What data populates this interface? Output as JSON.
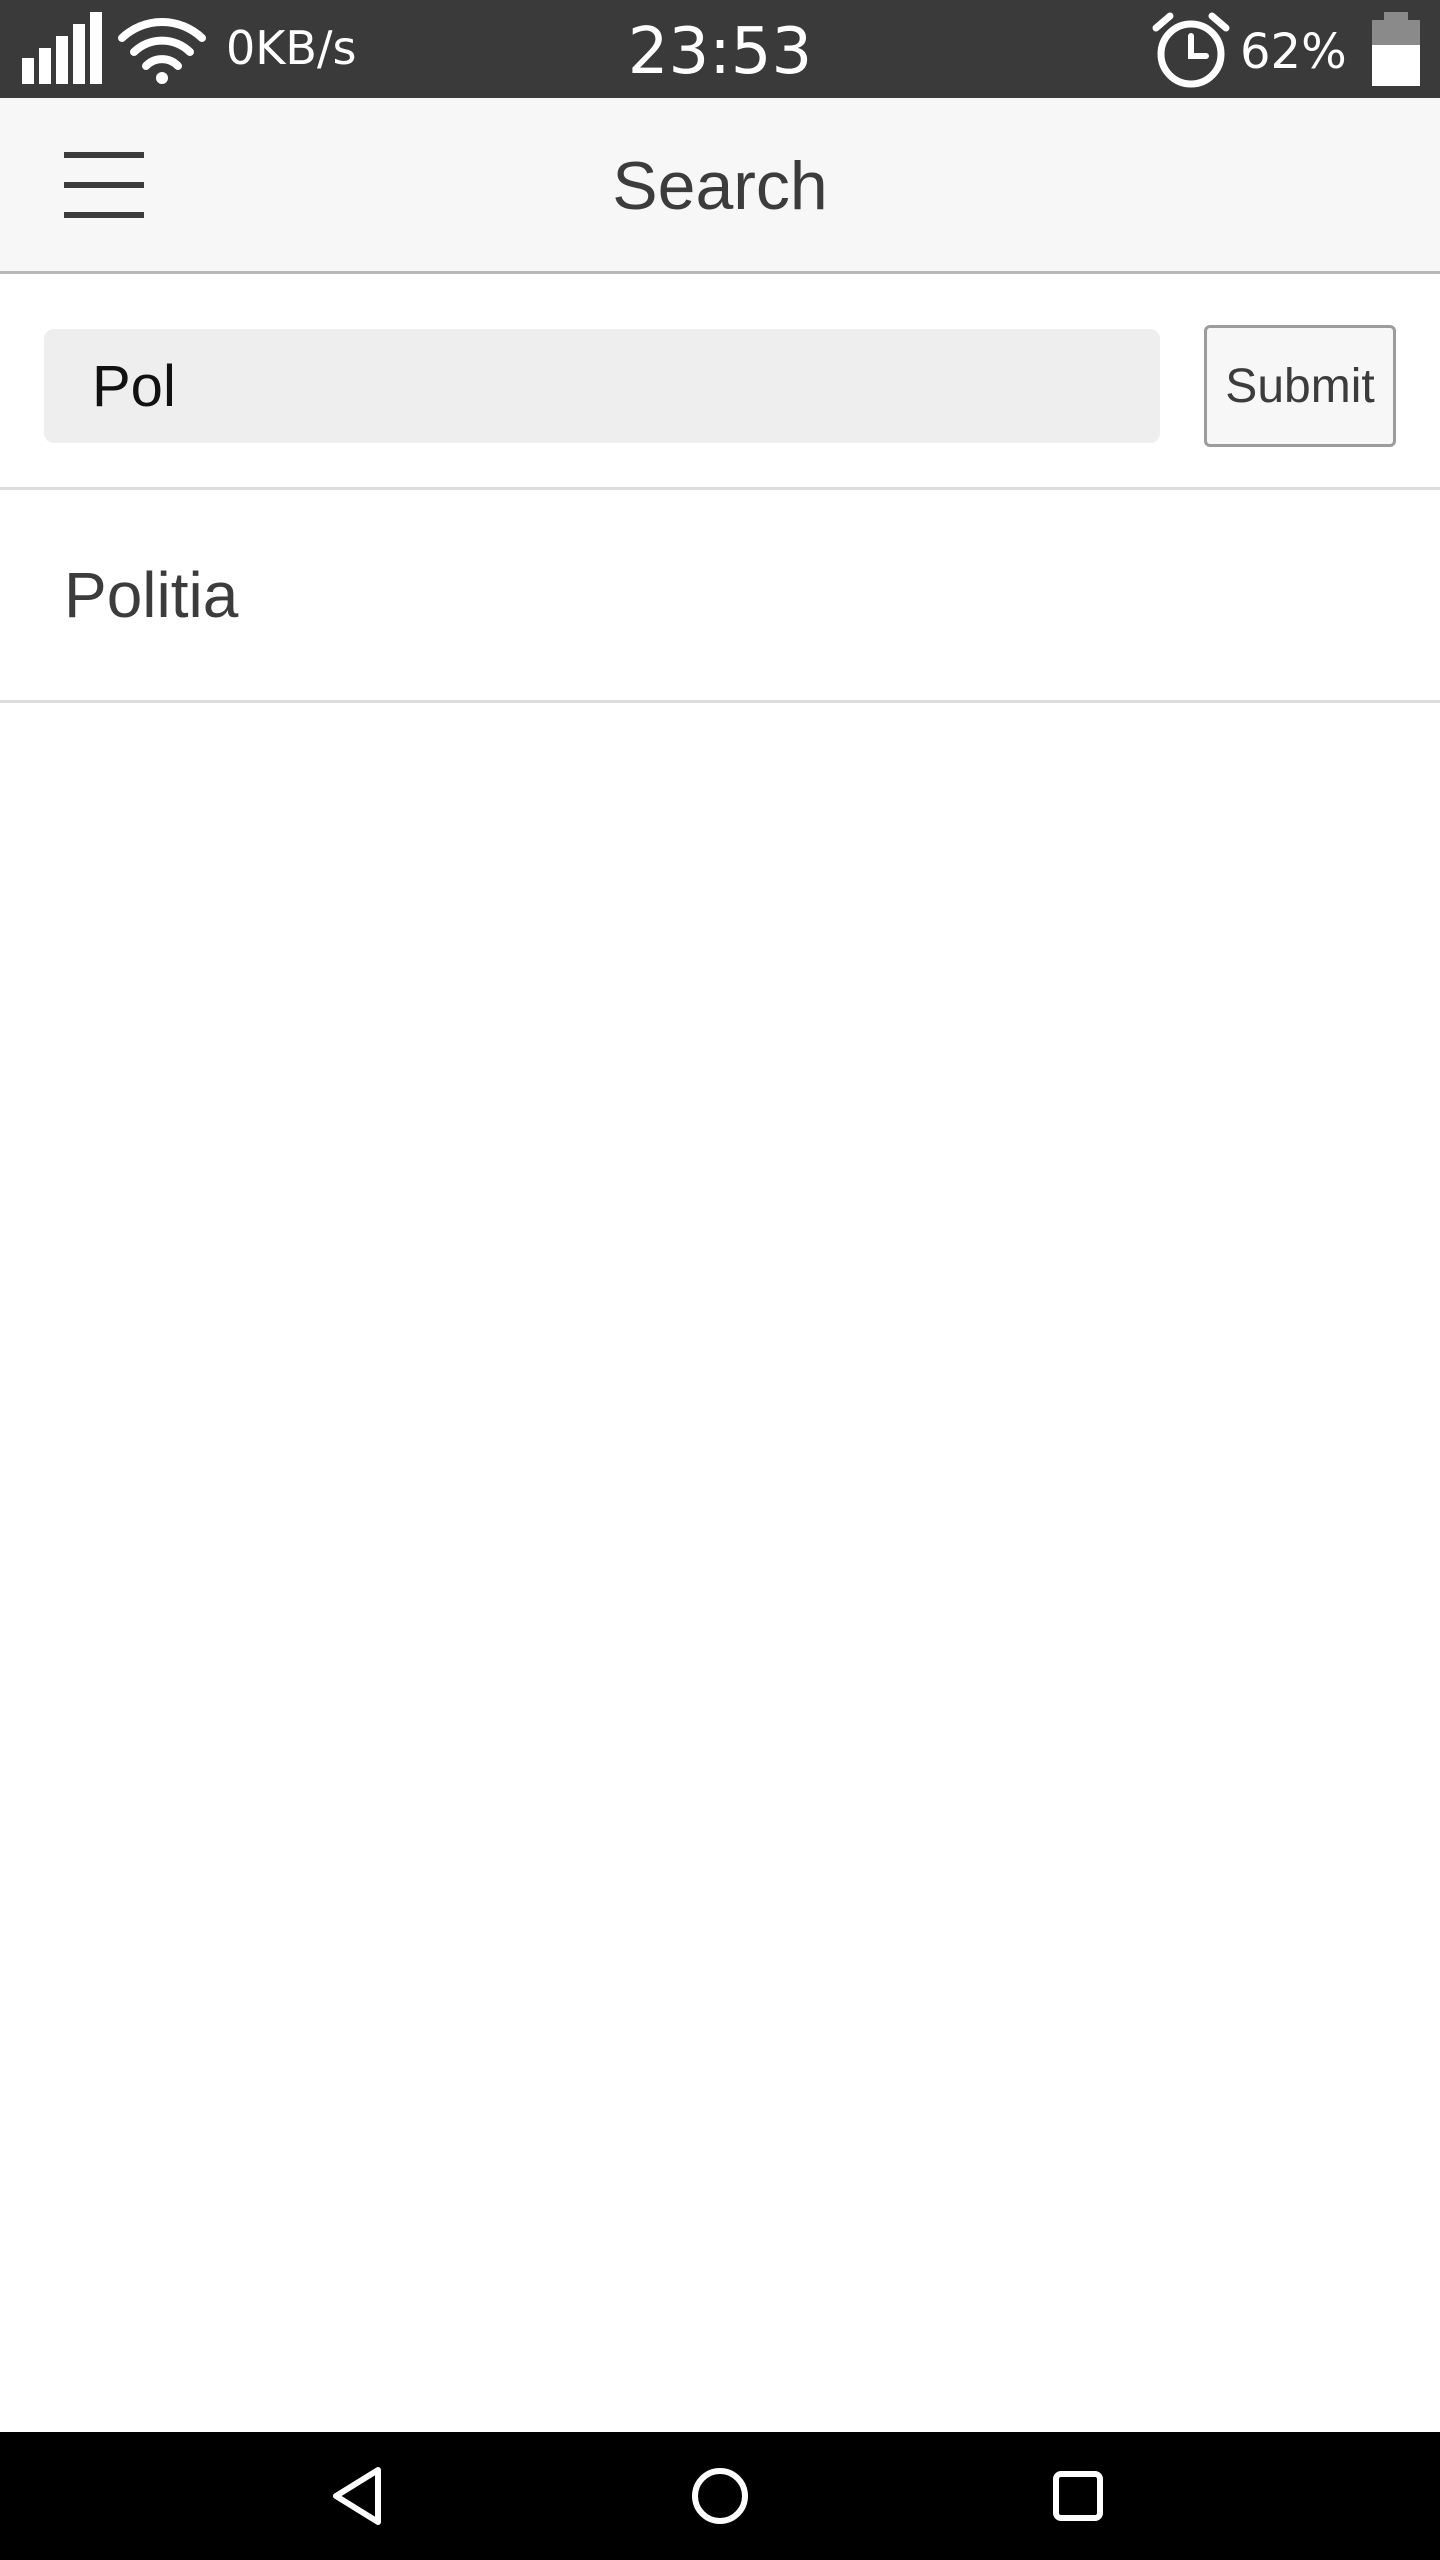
{
  "status_bar": {
    "net_speed": "0KB/s",
    "time": "23:53",
    "battery_percent": "62%",
    "battery_level": 0.62,
    "icons": [
      "signal-icon",
      "wifi-icon",
      "alarm-icon",
      "battery-icon"
    ]
  },
  "app_bar": {
    "title": "Search",
    "menu_icon": "hamburger-menu-icon"
  },
  "search": {
    "value": "Pol",
    "submit_label": "Submit"
  },
  "results": [
    {
      "label": "Politia"
    }
  ],
  "nav_bar": {
    "icons": [
      "back-icon",
      "home-icon",
      "recents-icon"
    ]
  },
  "colors": {
    "status_bar_bg": "#3a3a3a",
    "app_bar_bg": "#f7f7f7",
    "input_bg": "#eeeeee",
    "text": "#3c3c3c",
    "nav_bar_bg": "#000000"
  }
}
